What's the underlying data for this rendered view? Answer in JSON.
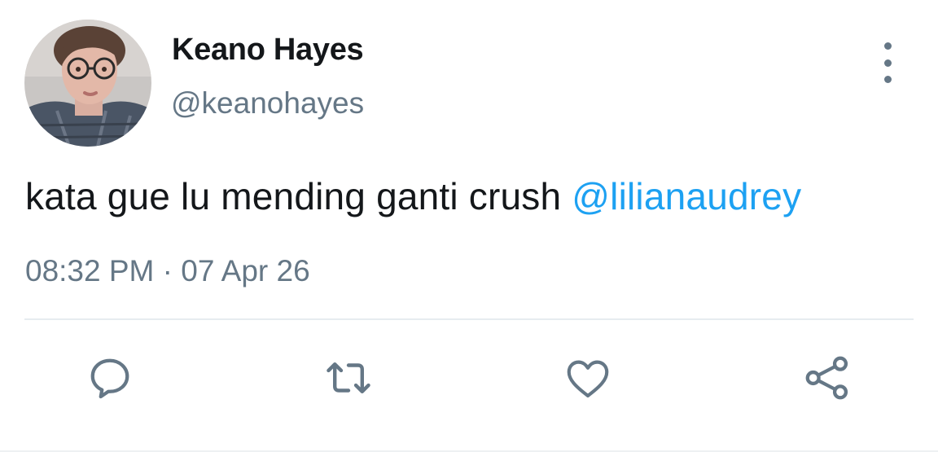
{
  "user": {
    "display_name": "Keano Hayes",
    "handle": "@keanohayes",
    "avatar": "avatar-photo"
  },
  "tweet": {
    "text": "kata gue lu mending ganti crush ",
    "mention": "@lilianaudrey",
    "timestamp": "08:32 PM · 07 Apr 26"
  },
  "actions": {
    "reply": "reply-icon",
    "retweet": "retweet-icon",
    "like": "heart-icon",
    "share": "share-icon",
    "more": "more-vertical-icon"
  },
  "colors": {
    "text": "#14171a",
    "secondary": "#657786",
    "accent": "#1da1f2",
    "divider": "#e6ecf0"
  }
}
